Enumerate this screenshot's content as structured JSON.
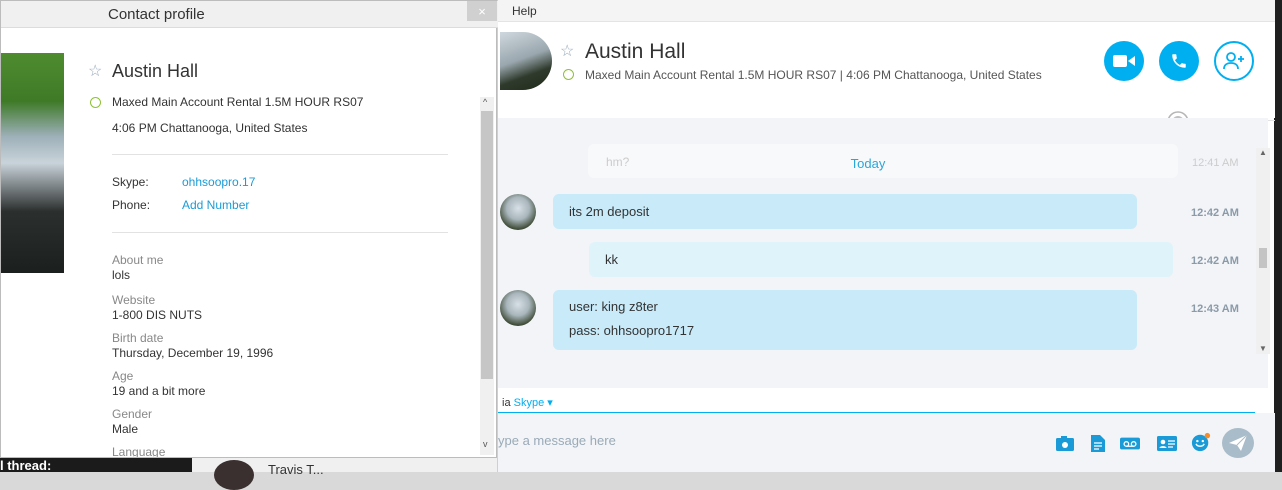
{
  "background": {
    "thread_text": "l thread:",
    "contact2_name": "Travis T..."
  },
  "chat": {
    "menu": {
      "help": "Help"
    },
    "contact": {
      "name": "Austin Hall",
      "mood": "Maxed Main Account Rental 1.5M HOUR RS07",
      "separator": "|",
      "local_time": "4:06 PM Chattanooga, United States"
    },
    "ghost_message": {
      "text": "hm?",
      "time": "12:41 AM"
    },
    "day_label": "Today",
    "messages": [
      {
        "lines": [
          "its 2m deposit"
        ],
        "time": "12:42 AM",
        "sender": "contact"
      },
      {
        "lines": [
          "kk"
        ],
        "time": "12:42 AM",
        "sender": "me"
      },
      {
        "lines": [
          "user: king z8ter",
          "pass: ohhsoopro1717"
        ],
        "time": "12:43 AM",
        "sender": "contact"
      }
    ],
    "via": {
      "prefix": "ia",
      "network": "Skype",
      "arrow": "▾"
    },
    "input": {
      "placeholder": "ype a message here"
    }
  },
  "profile": {
    "title": "Contact profile",
    "close": "×",
    "name": "Austin Hall",
    "mood": "Maxed Main Account Rental 1.5M HOUR RS07",
    "local_time": "4:06 PM Chattanooga, United States",
    "skype_label": "Skype:",
    "skype_value": "ohhsoopro.17",
    "phone_label": "Phone:",
    "phone_value": "Add Number",
    "fields": [
      {
        "label": "About me",
        "value": "lols"
      },
      {
        "label": "Website",
        "value": "1-800 DIS NUTS"
      },
      {
        "label": "Birth date",
        "value": "Thursday, December 19, 1996"
      },
      {
        "label": "Age",
        "value": "19 and a bit more"
      },
      {
        "label": "Gender",
        "value": "Male"
      },
      {
        "label": "Language",
        "value": ""
      }
    ]
  },
  "colors": {
    "accent": "#00aff0",
    "bubble": "#c8eaf9",
    "bubble_light": "#dff3fb",
    "online": "#8fc035"
  },
  "icons": [
    "star-icon",
    "video-icon",
    "phone-icon",
    "add-contact-icon",
    "globe-icon",
    "send-icon",
    "close-icon"
  ]
}
